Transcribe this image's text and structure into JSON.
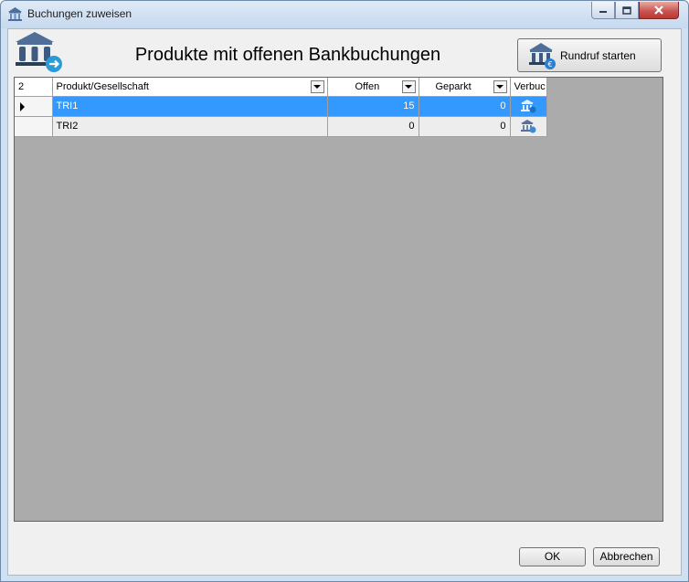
{
  "window": {
    "title": "Buchungen zuweisen"
  },
  "header": {
    "title": "Produkte mit offenen Bankbuchungen",
    "broadcast_button_label": "Rundruf starten"
  },
  "grid": {
    "row_count_label": "2",
    "columns": [
      "Produkt/Gesellschaft",
      "Offen",
      "Geparkt",
      "Verbuc"
    ],
    "rows": [
      {
        "product": "TRI1",
        "open": "15",
        "parked": "0",
        "selected": true
      },
      {
        "product": "TRI2",
        "open": "0",
        "parked": "0",
        "selected": false
      }
    ]
  },
  "footer": {
    "ok_label": "OK",
    "cancel_label": "Abbrechen"
  },
  "colors": {
    "selection": "#3399ff",
    "grid_background": "#ababab",
    "icon_blue": "#2f6fb3"
  }
}
